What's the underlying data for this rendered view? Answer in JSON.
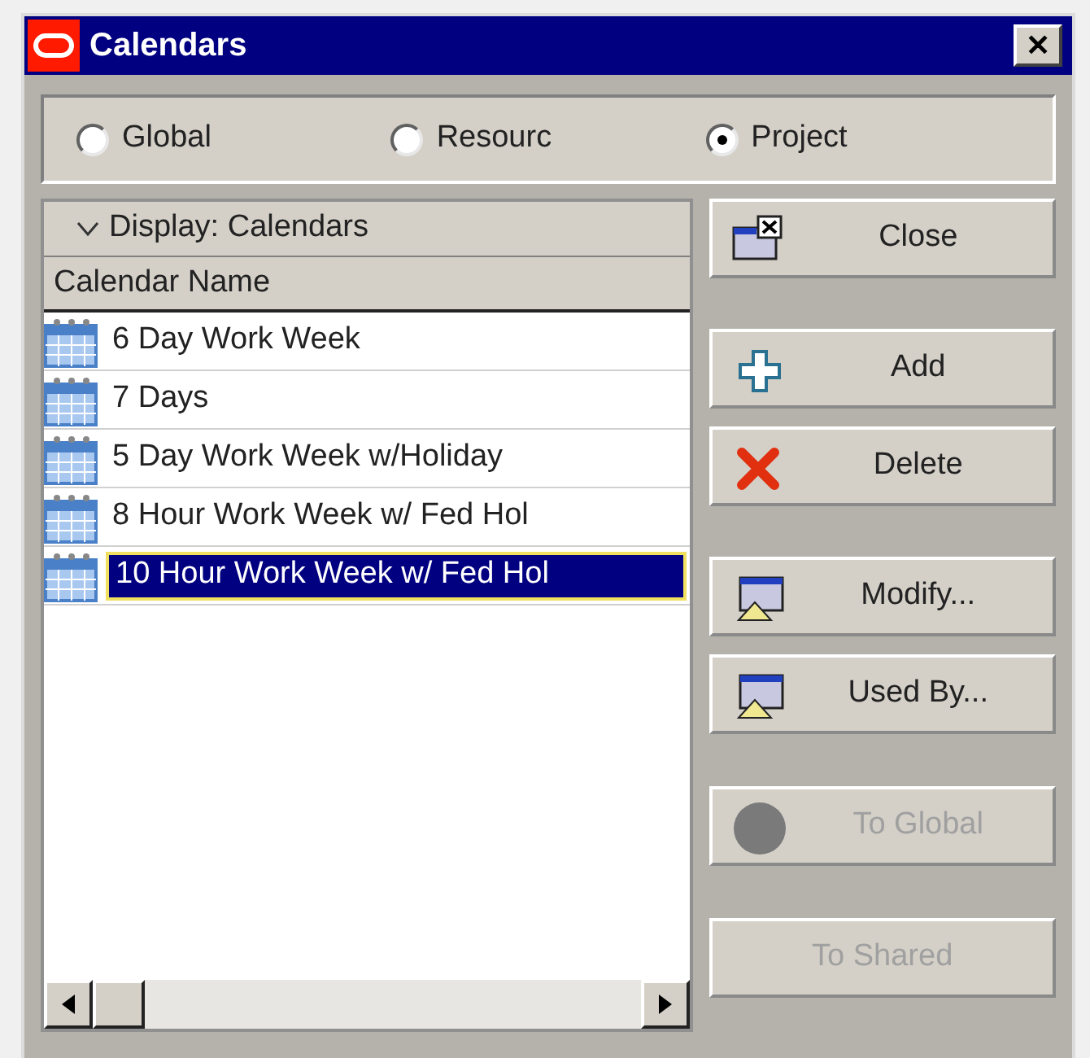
{
  "window": {
    "title": "Calendars",
    "close": "✕"
  },
  "scope": [
    {
      "label": "Global",
      "selected": false
    },
    {
      "label": "Resourc",
      "selected": false
    },
    {
      "label": "Project",
      "selected": true
    }
  ],
  "list": {
    "display": "Display: Calendars",
    "column": "Calendar Name",
    "rows": [
      {
        "name": "6 Day Work Week",
        "selected": false
      },
      {
        "name": "7 Days",
        "selected": false
      },
      {
        "name": "5 Day Work Week w/Holiday",
        "selected": false
      },
      {
        "name": "8 Hour Work Week w/ Fed Hol",
        "selected": false
      },
      {
        "name": "10 Hour Work Week w/ Fed Hol",
        "selected": true
      }
    ]
  },
  "buttons": [
    {
      "label": "Close",
      "disabled": false
    },
    {
      "label": "Add",
      "disabled": false
    },
    {
      "label": "Delete",
      "disabled": false
    },
    {
      "label": "Modify...",
      "disabled": false
    },
    {
      "label": "Used By...",
      "disabled": false
    },
    {
      "label": "To Global",
      "disabled": true
    },
    {
      "label": "To Shared",
      "disabled": true
    }
  ]
}
